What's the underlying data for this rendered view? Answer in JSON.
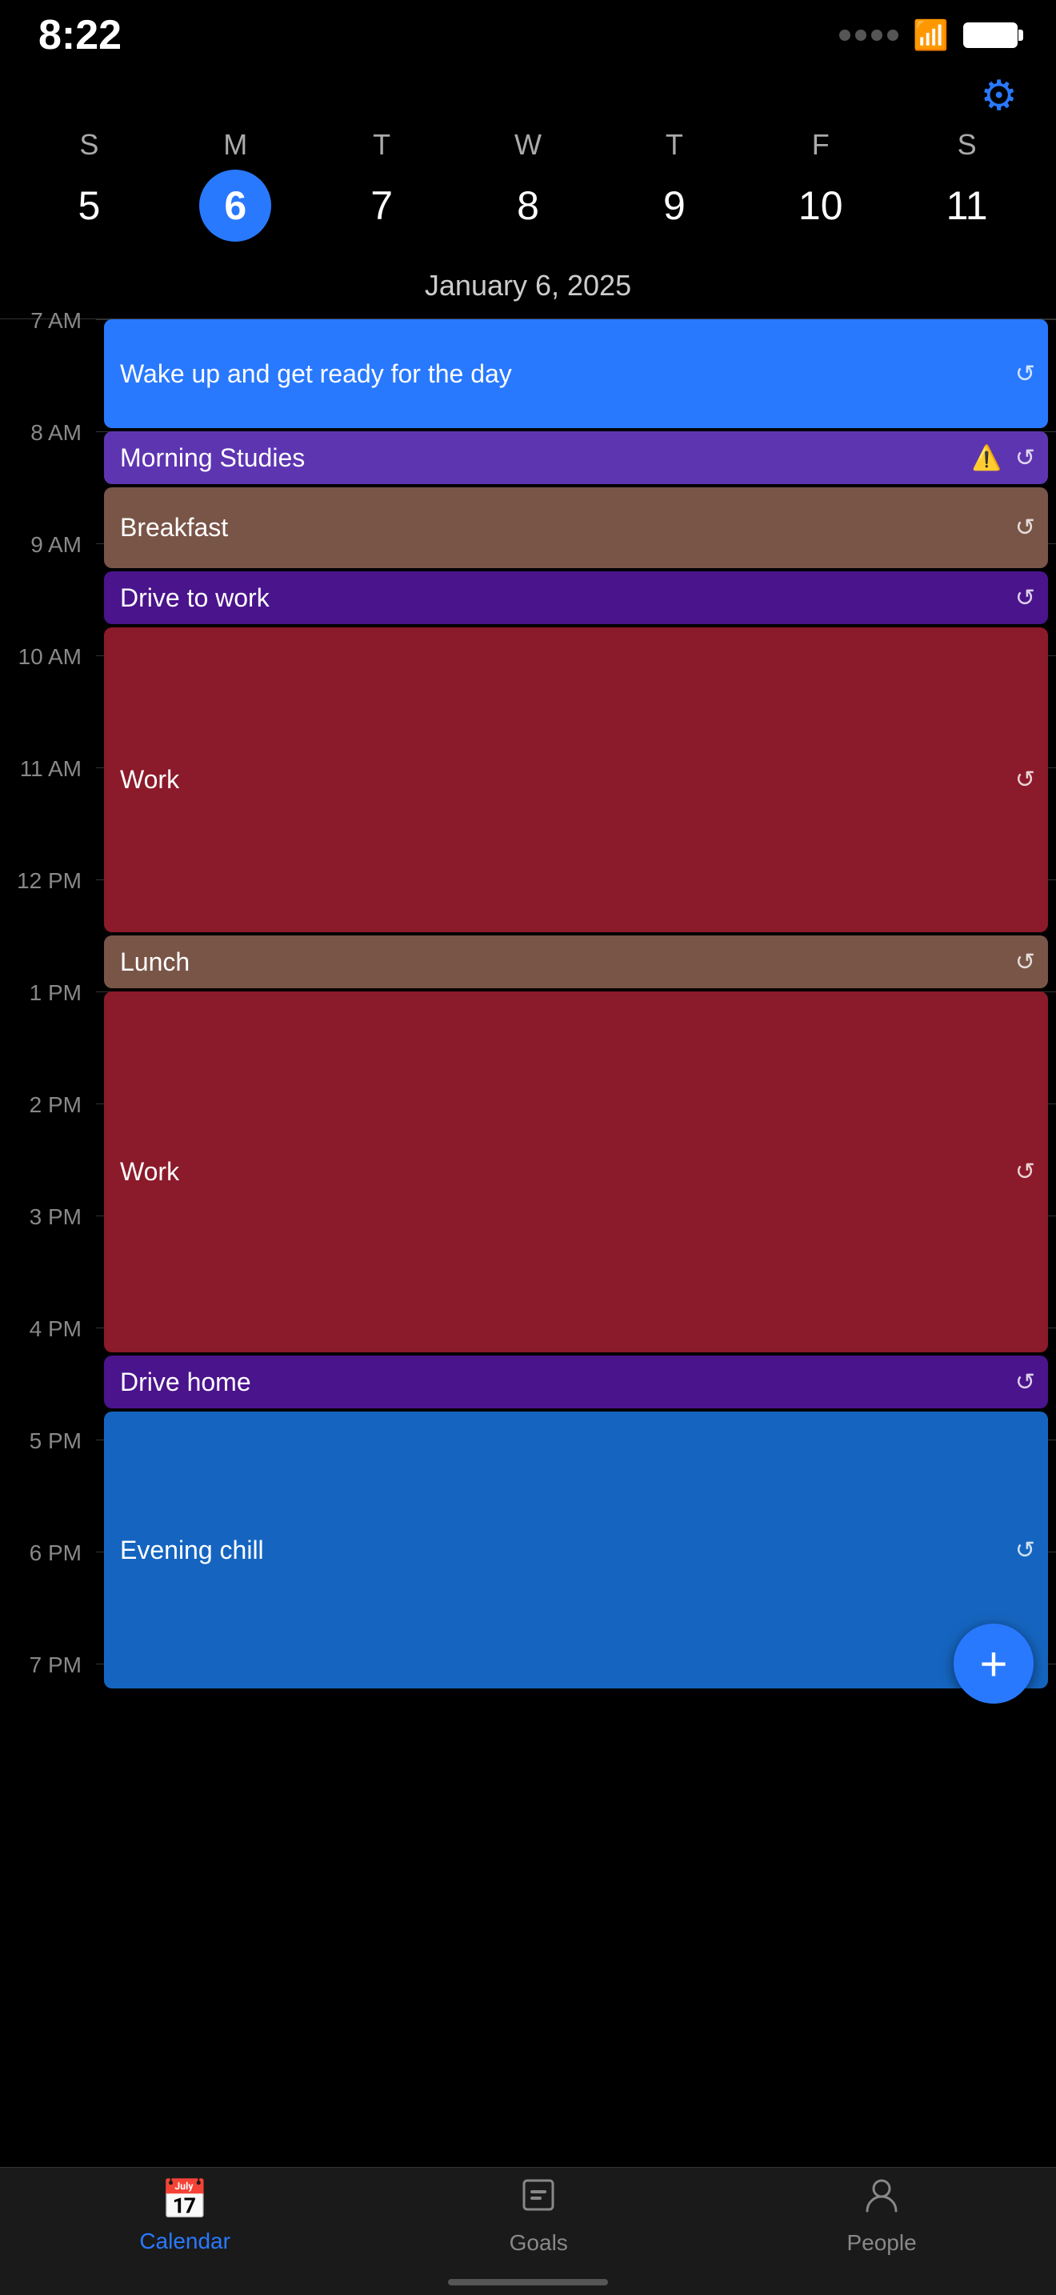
{
  "status": {
    "time": "8:22",
    "wifi": true,
    "battery_full": true
  },
  "header": {
    "selected_date": "January 6, 2025",
    "gear_label": "⚙"
  },
  "week": {
    "day_labels": [
      "S",
      "M",
      "T",
      "W",
      "T",
      "F",
      "S"
    ],
    "dates": [
      "5",
      "6",
      "7",
      "8",
      "9",
      "10",
      "11"
    ],
    "active_index": 1
  },
  "events": [
    {
      "id": "wake-up",
      "title": "Wake up and get ready for the day",
      "color": "#2979FF",
      "start_hour_offset": 0,
      "duration_slots": 1.0,
      "has_repeat": true,
      "has_warning": false
    },
    {
      "id": "morning-studies",
      "title": "Morning Studies",
      "color": "#5E35B1",
      "start_hour_offset": 1.0,
      "duration_slots": 0.5,
      "has_repeat": true,
      "has_warning": true
    },
    {
      "id": "breakfast",
      "title": "Breakfast",
      "color": "#795548",
      "start_hour_offset": 1.5,
      "duration_slots": 0.75,
      "has_repeat": true,
      "has_warning": false
    },
    {
      "id": "drive-to-work",
      "title": "Drive to work",
      "color": "#4A148C",
      "start_hour_offset": 2.25,
      "duration_slots": 0.5,
      "has_repeat": true,
      "has_warning": false
    },
    {
      "id": "work-morning",
      "title": "Work",
      "color": "#8B1A2A",
      "start_hour_offset": 2.75,
      "duration_slots": 2.75,
      "has_repeat": true,
      "has_warning": false
    },
    {
      "id": "lunch",
      "title": "Lunch",
      "color": "#795548",
      "start_hour_offset": 5.5,
      "duration_slots": 0.5,
      "has_repeat": true,
      "has_warning": false
    },
    {
      "id": "work-afternoon",
      "title": "Work",
      "color": "#8B1A2A",
      "start_hour_offset": 6.0,
      "duration_slots": 3.25,
      "has_repeat": true,
      "has_warning": false
    },
    {
      "id": "drive-home",
      "title": "Drive home",
      "color": "#4A148C",
      "start_hour_offset": 9.25,
      "duration_slots": 0.5,
      "has_repeat": true,
      "has_warning": false
    },
    {
      "id": "evening-chill",
      "title": "Evening chill",
      "color": "#1565C0",
      "start_hour_offset": 9.75,
      "duration_slots": 2.5,
      "has_repeat": true,
      "has_warning": false
    }
  ],
  "time_labels": [
    "7 AM",
    "8 AM",
    "9 AM",
    "10 AM",
    "11 AM",
    "12 PM",
    "1 PM",
    "2 PM",
    "3 PM",
    "4 PM",
    "5 PM",
    "6 PM",
    "7 PM"
  ],
  "bottom_nav": {
    "items": [
      {
        "id": "calendar",
        "label": "Calendar",
        "icon": "▦",
        "active": true
      },
      {
        "id": "goals",
        "label": "Goals",
        "icon": "▣",
        "active": false
      },
      {
        "id": "people",
        "label": "People",
        "icon": "👤",
        "active": false
      }
    ],
    "fab_label": "+"
  }
}
